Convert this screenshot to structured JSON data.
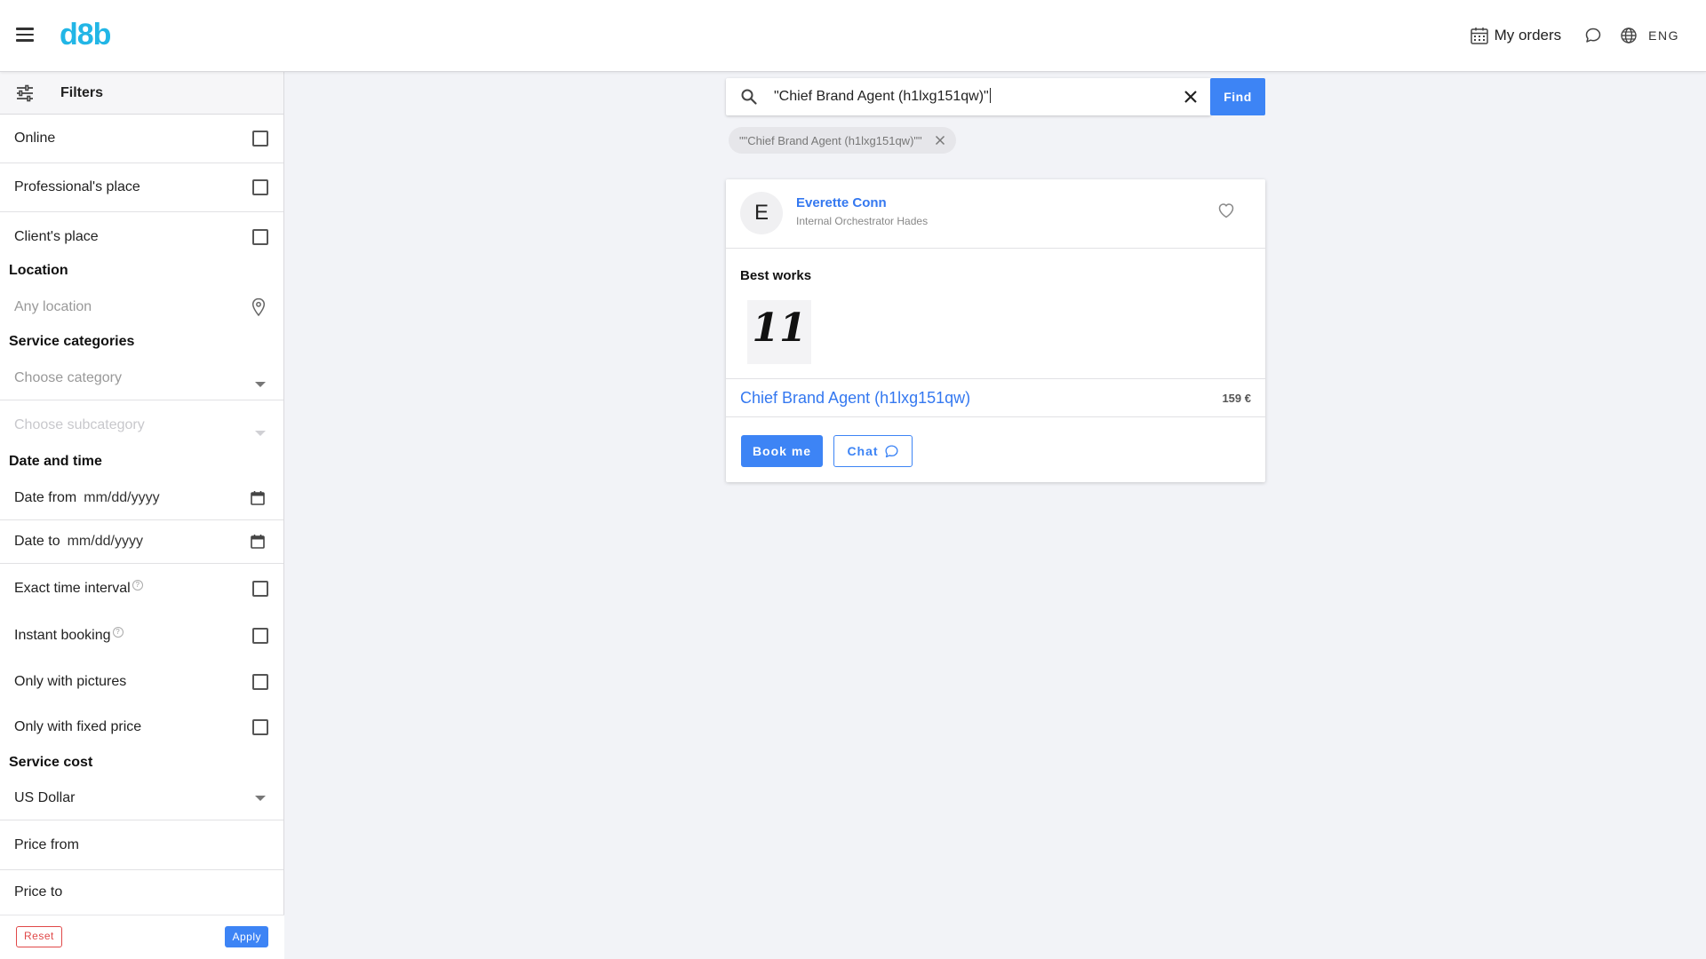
{
  "header": {
    "logo": "d8b",
    "my_orders_label": "My orders",
    "language": "ENG",
    "icons": [
      "menu-icon",
      "calendar-icon",
      "chat-bubble-icon",
      "globe-icon"
    ]
  },
  "sidebar": {
    "title": "Filters",
    "online": "Online",
    "professionals_place": "Professional's place",
    "clients_place": "Client's place",
    "location_section": "Location",
    "location_placeholder": "Any location",
    "categories_section": "Service categories",
    "category_placeholder": "Choose category",
    "subcategory_placeholder": "Choose subcategory",
    "datetime_section": "Date and time",
    "date_from_label": "Date from",
    "date_from_value": "mm/dd/yyyy",
    "date_to_label": "Date to",
    "date_to_value": "mm/dd/yyyy",
    "exact_time": "Exact time interval",
    "instant_booking": "Instant booking",
    "only_pictures": "Only with pictures",
    "only_fixed_price": "Only with fixed price",
    "cost_section": "Service cost",
    "currency": "US Dollar",
    "price_from": "Price from",
    "price_to": "Price to",
    "reset_label": "Reset",
    "apply_label": "Apply"
  },
  "search": {
    "value": "\"Chief Brand Agent (h1lxg151qw)\"",
    "find_label": "Find",
    "chip": "\"\"Chief Brand Agent (h1lxg151qw)\"\""
  },
  "result": {
    "avatar_letter": "E",
    "name": "Everette Conn",
    "role": "Internal Orchestrator Hades",
    "best_works_title": "Best works",
    "work_thumb_text": "11",
    "service_name": "Chief Brand Agent (h1lxg151qw)",
    "price": "159 €",
    "book_label": "Book me",
    "chat_label": "Chat"
  },
  "colors": {
    "accent": "#3d84f5",
    "link": "#3478f0",
    "logo": "#22b6e6",
    "reset": "#e04848",
    "background": "#f2f3f7"
  }
}
